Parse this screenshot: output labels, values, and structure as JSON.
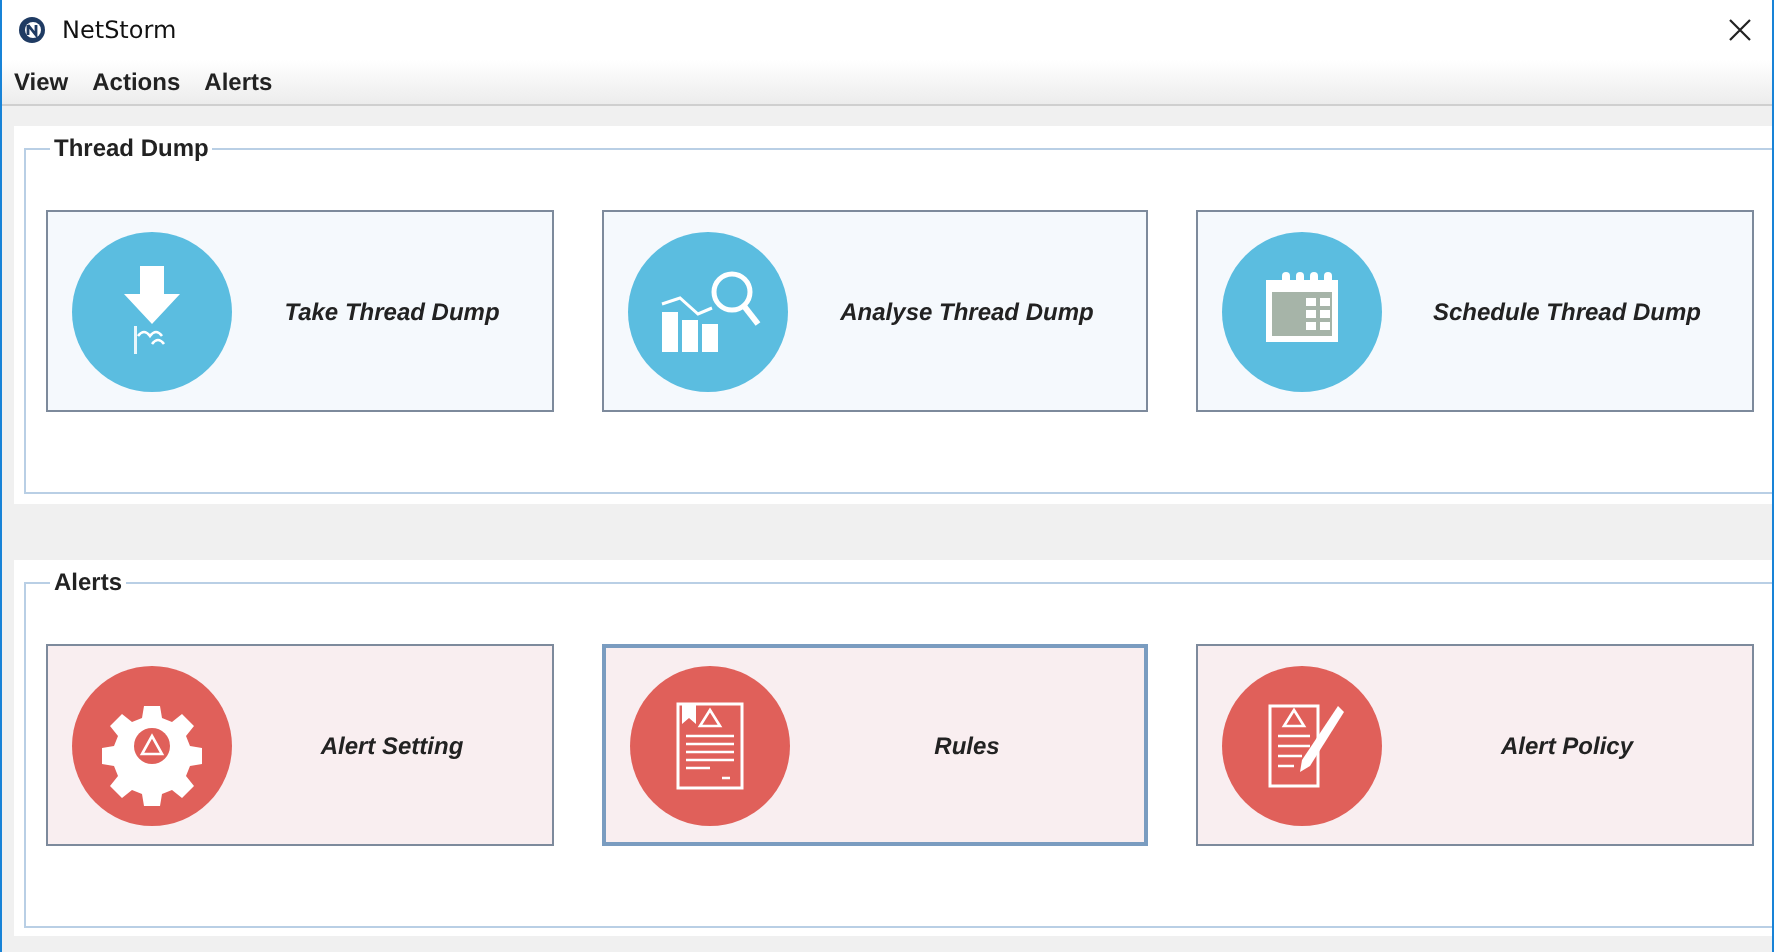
{
  "window": {
    "title": "NetStorm"
  },
  "menu": [
    "View",
    "Actions",
    "Alerts"
  ],
  "sections": [
    {
      "title": "Thread Dump",
      "kind": "dump",
      "cards": [
        {
          "label": "Take Thread Dump",
          "selected": false
        },
        {
          "label": "Analyse Thread Dump",
          "selected": false
        },
        {
          "label": "Schedule Thread Dump",
          "selected": false
        }
      ]
    },
    {
      "title": "Alerts",
      "kind": "alert",
      "cards": [
        {
          "label": "Alert Setting",
          "selected": false
        },
        {
          "label": "Rules",
          "selected": true
        },
        {
          "label": "Alert Policy",
          "selected": false
        }
      ]
    }
  ]
}
